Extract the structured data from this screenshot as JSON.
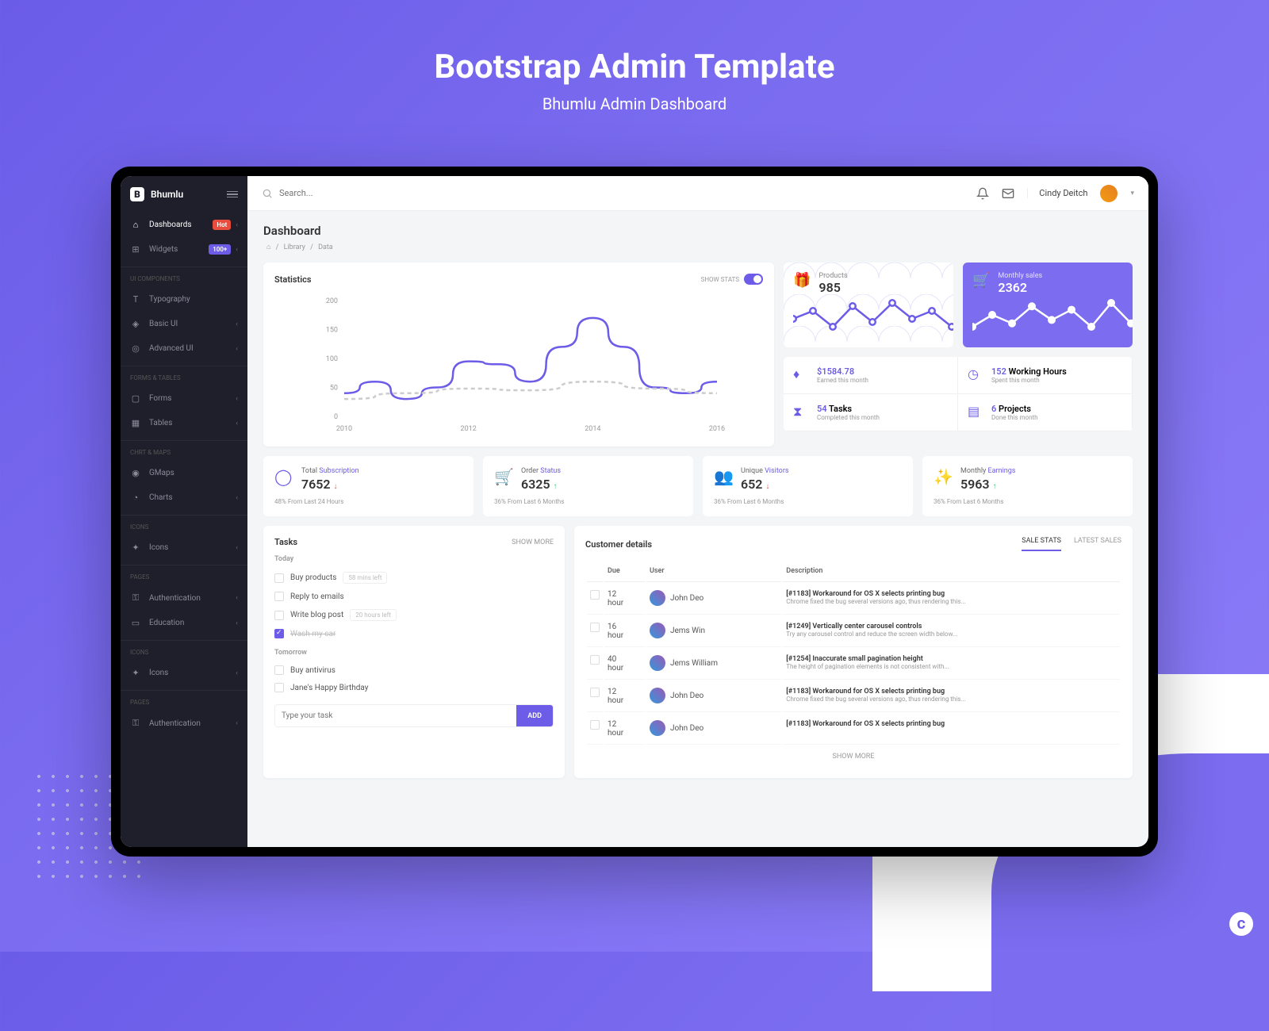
{
  "hero": {
    "title": "Bootstrap Admin Template",
    "subtitle": "Bhumlu Admin Dashboard"
  },
  "brand": "Bhumlu",
  "search": {
    "placeholder": "Search..."
  },
  "user": {
    "name": "Cindy Deitch"
  },
  "sidebar": {
    "items": [
      {
        "icon": "⌂",
        "label": "Dashboards",
        "badge": "Hot",
        "badgeClass": "badge-hot",
        "chev": true,
        "active": true
      },
      {
        "icon": "⊞",
        "label": "Widgets",
        "badge": "100+",
        "badgeClass": "badge-count",
        "chev": true
      }
    ],
    "sections": [
      {
        "title": "UI Components",
        "items": [
          {
            "icon": "T",
            "label": "Typography"
          },
          {
            "icon": "◈",
            "label": "Basic UI",
            "chev": true
          },
          {
            "icon": "◎",
            "label": "Advanced UI",
            "chev": true
          }
        ]
      },
      {
        "title": "Forms & Tables",
        "items": [
          {
            "icon": "▢",
            "label": "Forms",
            "chev": true
          },
          {
            "icon": "▦",
            "label": "Tables",
            "chev": true
          }
        ]
      },
      {
        "title": "Chrt & Maps",
        "items": [
          {
            "icon": "◉",
            "label": "GMaps"
          },
          {
            "icon": "◔",
            "label": "Charts",
            "chev": true
          }
        ]
      },
      {
        "title": "Icons",
        "items": [
          {
            "icon": "✦",
            "label": "Icons",
            "chev": true
          }
        ]
      },
      {
        "title": "Pages",
        "items": [
          {
            "icon": "⚿",
            "label": "Authentication",
            "chev": true
          },
          {
            "icon": "▭",
            "label": "Education",
            "chev": true
          }
        ]
      },
      {
        "title": "Icons",
        "items": [
          {
            "icon": "✦",
            "label": "Icons",
            "chev": true
          }
        ]
      },
      {
        "title": "Pages",
        "items": [
          {
            "icon": "⚿",
            "label": "Authentication",
            "chev": true
          }
        ]
      }
    ]
  },
  "page": {
    "title": "Dashboard",
    "breadcrumb": [
      "⌂",
      "Library",
      "Data"
    ]
  },
  "chart_data": {
    "type": "line",
    "title": "Statistics",
    "xlabel": "",
    "ylabel": "",
    "x_ticks": [
      2010,
      2012,
      2014,
      2016
    ],
    "y_ticks": [
      0,
      50,
      100,
      150,
      200
    ],
    "ylim": [
      0,
      200
    ],
    "series": [
      {
        "name": "primary",
        "x": [
          2010,
          2010.5,
          2011,
          2011.5,
          2012,
          2012.5,
          2013,
          2013.5,
          2014,
          2014.5,
          2015,
          2015.5,
          2016
        ],
        "y": [
          40,
          60,
          30,
          50,
          95,
          90,
          60,
          120,
          170,
          120,
          50,
          40,
          60
        ],
        "color": "#6c5ce7"
      },
      {
        "name": "secondary",
        "x": [
          2010,
          2011,
          2012,
          2013,
          2014,
          2015,
          2016
        ],
        "y": [
          30,
          40,
          48,
          45,
          60,
          48,
          40
        ],
        "color": "#cccccc",
        "dashed": true
      }
    ]
  },
  "stats_toggle": "SHOW STATS",
  "tiles": {
    "products": {
      "label": "Products",
      "value": "985",
      "spark": [
        30,
        35,
        25,
        38,
        28,
        40,
        30,
        35,
        25,
        38
      ]
    },
    "monthly_sales": {
      "label": "Monthly sales",
      "value": "2362",
      "spark": [
        28,
        35,
        30,
        40,
        32,
        38,
        28,
        42,
        30,
        36
      ]
    }
  },
  "info": [
    {
      "icon": "♦",
      "value": "$1584.78",
      "sub": "Earned this month"
    },
    {
      "icon": "◷",
      "value": "152",
      "suffix": "Working Hours",
      "sub": "Spent this month"
    },
    {
      "icon": "⧗",
      "value": "54",
      "suffix": "Tasks",
      "sub": "Completed this month"
    },
    {
      "icon": "▤",
      "value": "6",
      "suffix": "Projects",
      "sub": "Done this month"
    }
  ],
  "stats": [
    {
      "icon": "◯",
      "label_pre": "Total",
      "label_accent": "Subscription",
      "value": "7652",
      "dir": "down",
      "sub": "48% From Last 24 Hours"
    },
    {
      "icon": "🛒",
      "label_pre": "Order",
      "label_accent": "Status",
      "value": "6325",
      "dir": "up",
      "sub": "36% From Last 6 Months"
    },
    {
      "icon": "👥",
      "label_pre": "Unique",
      "label_accent": "Visitors",
      "value": "652",
      "dir": "down",
      "sub": "36% From Last 6 Months"
    },
    {
      "icon": "✨",
      "label_pre": "Monthly",
      "label_accent": "Earnings",
      "value": "5963",
      "dir": "up",
      "sub": "36% From Last 6 Months"
    }
  ],
  "tasks": {
    "title": "Tasks",
    "more": "SHOW MORE",
    "today_label": "Today",
    "today": [
      {
        "text": "Buy products",
        "time": "58 mins left"
      },
      {
        "text": "Reply to emails"
      },
      {
        "text": "Write blog post",
        "time": "20 hours left"
      },
      {
        "text": "Wash my car",
        "done": true
      }
    ],
    "tomorrow_label": "Tomorrow",
    "tomorrow": [
      {
        "text": "Buy antivirus"
      },
      {
        "text": "Jane's Happy Birthday"
      }
    ],
    "input_placeholder": "Type your task",
    "add_label": "ADD"
  },
  "customers": {
    "title": "Customer details",
    "tabs": [
      "SALE STATS",
      "LATEST SALES"
    ],
    "active_tab": 0,
    "cols": [
      "Due",
      "User",
      "Description"
    ],
    "rows": [
      {
        "due": "12 hour",
        "user": "John Deo",
        "title": "[#1183] Workaround for OS X selects printing bug",
        "desc": "Chrome fixed the bug several versions ago, thus rendering this..."
      },
      {
        "due": "16 hour",
        "user": "Jems Win",
        "title": "[#1249] Vertically center carousel controls",
        "desc": "Try any carousel control and reduce the screen width below..."
      },
      {
        "due": "40 hour",
        "user": "Jems William",
        "title": "[#1254] Inaccurate small pagination height",
        "desc": "The height of pagination elements is not consistent with..."
      },
      {
        "due": "12 hour",
        "user": "John Deo",
        "title": "[#1183] Workaround for OS X selects printing bug",
        "desc": "Chrome fixed the bug several versions ago, thus rendering this..."
      },
      {
        "due": "12 hour",
        "user": "John Deo",
        "title": "[#1183] Workaround for OS X selects printing bug",
        "desc": ""
      }
    ],
    "more": "SHOW MORE"
  }
}
